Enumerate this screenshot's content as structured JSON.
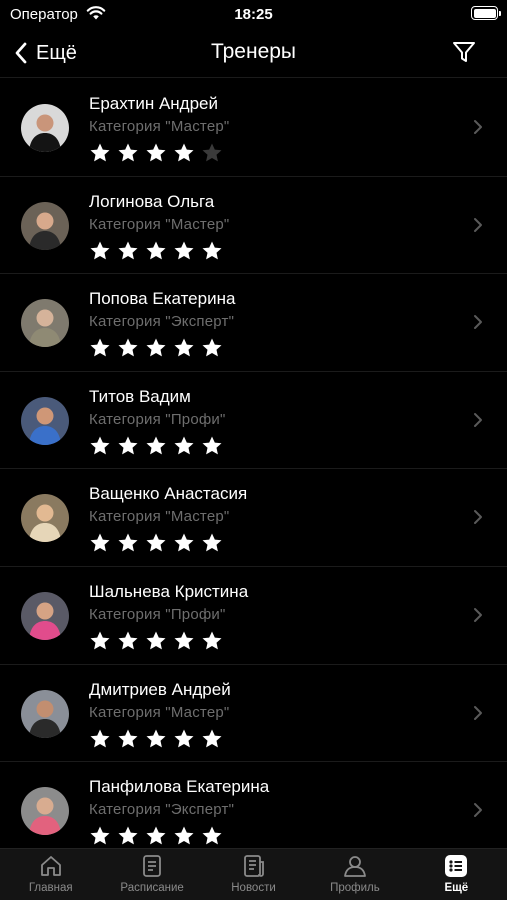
{
  "status_bar": {
    "carrier": "Оператор",
    "time": "18:25"
  },
  "nav": {
    "back_label": "Ещё",
    "title": "Тренеры"
  },
  "trainers": [
    {
      "name": "Ерахтин Андрей",
      "category": "Категория \"Мастер\"",
      "rating": 4
    },
    {
      "name": "Логинова Ольга",
      "category": "Категория \"Мастер\"",
      "rating": 5
    },
    {
      "name": "Попова Екатерина",
      "category": "Категория \"Эксперт\"",
      "rating": 5
    },
    {
      "name": "Титов Вадим",
      "category": "Категория \"Профи\"",
      "rating": 5
    },
    {
      "name": "Ващенко Анастасия",
      "category": "Категория \"Мастер\"",
      "rating": 5
    },
    {
      "name": "Шальнева Кристина",
      "category": "Категория \"Профи\"",
      "rating": 5
    },
    {
      "name": "Дмитриев Андрей",
      "category": "Категория \"Мастер\"",
      "rating": 5
    },
    {
      "name": "Панфилова Екатерина",
      "category": "Категория \"Эксперт\"",
      "rating": 5
    }
  ],
  "tabs": [
    {
      "label": "Главная",
      "icon": "home-icon",
      "active": false
    },
    {
      "label": "Расписание",
      "icon": "schedule-icon",
      "active": false
    },
    {
      "label": "Новости",
      "icon": "news-icon",
      "active": false
    },
    {
      "label": "Профиль",
      "icon": "profile-icon",
      "active": false
    },
    {
      "label": "Ещё",
      "icon": "more-icon",
      "active": true
    }
  ],
  "colors": {
    "background": "#000000",
    "text": "#ffffff",
    "secondary_text": "#6e6e6e",
    "inactive_star": "#3a3a3a",
    "tab_bar": "#141414"
  }
}
